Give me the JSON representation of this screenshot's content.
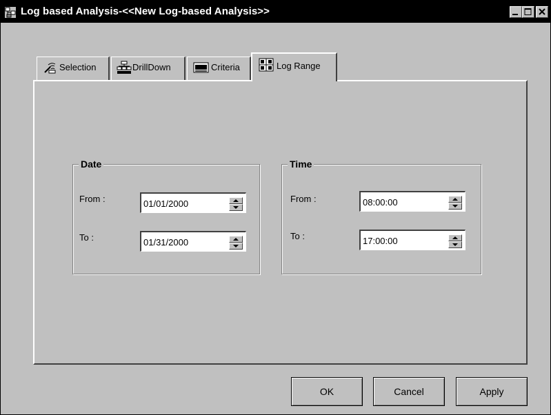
{
  "window": {
    "title": "Log based Analysis-<<New Log-based Analysis>>"
  },
  "titlebar_icons": [
    "minimize-icon",
    "maximize-icon",
    "close-icon"
  ],
  "tabs": [
    {
      "label": "Selection",
      "icon": "selection-icon",
      "active": false
    },
    {
      "label": "DrillDown",
      "icon": "drilldown-icon",
      "active": false
    },
    {
      "label": "Criteria",
      "icon": "criteria-icon",
      "active": false
    },
    {
      "label": "Log Range",
      "icon": "log-range-icon",
      "active": true
    }
  ],
  "date_group": {
    "title": "Date",
    "from_label": "From :",
    "from_value": "01/01/2000",
    "to_label": "To :",
    "to_value": "01/31/2000"
  },
  "time_group": {
    "title": "Time",
    "from_label": "From :",
    "from_value": "08:00:00",
    "to_label": "To :",
    "to_value": "17:00:00"
  },
  "buttons": {
    "ok": "OK",
    "cancel": "Cancel",
    "apply": "Apply"
  },
  "colors": {
    "face": "#c0c0c0",
    "titlebar": "#000000",
    "field": "#ffffff"
  }
}
